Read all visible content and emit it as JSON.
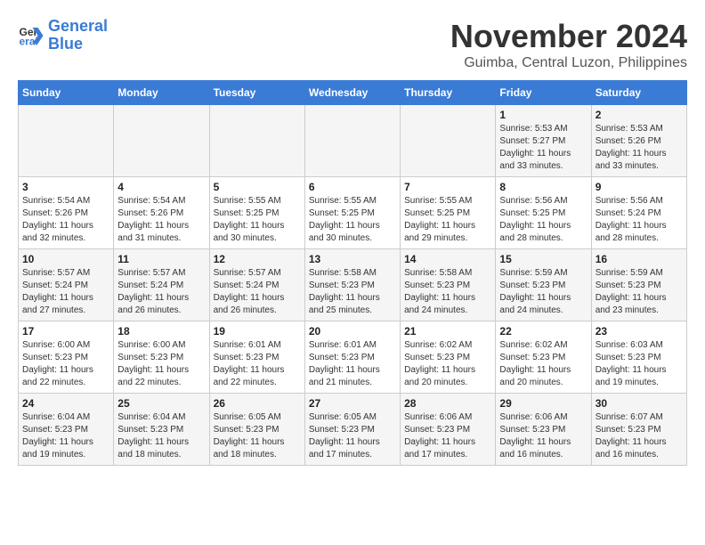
{
  "header": {
    "logo_line1": "General",
    "logo_line2": "Blue",
    "month_title": "November 2024",
    "location": "Guimba, Central Luzon, Philippines"
  },
  "weekdays": [
    "Sunday",
    "Monday",
    "Tuesday",
    "Wednesday",
    "Thursday",
    "Friday",
    "Saturday"
  ],
  "weeks": [
    [
      {
        "day": "",
        "info": ""
      },
      {
        "day": "",
        "info": ""
      },
      {
        "day": "",
        "info": ""
      },
      {
        "day": "",
        "info": ""
      },
      {
        "day": "",
        "info": ""
      },
      {
        "day": "1",
        "info": "Sunrise: 5:53 AM\nSunset: 5:27 PM\nDaylight: 11 hours and 33 minutes."
      },
      {
        "day": "2",
        "info": "Sunrise: 5:53 AM\nSunset: 5:26 PM\nDaylight: 11 hours and 33 minutes."
      }
    ],
    [
      {
        "day": "3",
        "info": "Sunrise: 5:54 AM\nSunset: 5:26 PM\nDaylight: 11 hours and 32 minutes."
      },
      {
        "day": "4",
        "info": "Sunrise: 5:54 AM\nSunset: 5:26 PM\nDaylight: 11 hours and 31 minutes."
      },
      {
        "day": "5",
        "info": "Sunrise: 5:55 AM\nSunset: 5:25 PM\nDaylight: 11 hours and 30 minutes."
      },
      {
        "day": "6",
        "info": "Sunrise: 5:55 AM\nSunset: 5:25 PM\nDaylight: 11 hours and 30 minutes."
      },
      {
        "day": "7",
        "info": "Sunrise: 5:55 AM\nSunset: 5:25 PM\nDaylight: 11 hours and 29 minutes."
      },
      {
        "day": "8",
        "info": "Sunrise: 5:56 AM\nSunset: 5:25 PM\nDaylight: 11 hours and 28 minutes."
      },
      {
        "day": "9",
        "info": "Sunrise: 5:56 AM\nSunset: 5:24 PM\nDaylight: 11 hours and 28 minutes."
      }
    ],
    [
      {
        "day": "10",
        "info": "Sunrise: 5:57 AM\nSunset: 5:24 PM\nDaylight: 11 hours and 27 minutes."
      },
      {
        "day": "11",
        "info": "Sunrise: 5:57 AM\nSunset: 5:24 PM\nDaylight: 11 hours and 26 minutes."
      },
      {
        "day": "12",
        "info": "Sunrise: 5:57 AM\nSunset: 5:24 PM\nDaylight: 11 hours and 26 minutes."
      },
      {
        "day": "13",
        "info": "Sunrise: 5:58 AM\nSunset: 5:23 PM\nDaylight: 11 hours and 25 minutes."
      },
      {
        "day": "14",
        "info": "Sunrise: 5:58 AM\nSunset: 5:23 PM\nDaylight: 11 hours and 24 minutes."
      },
      {
        "day": "15",
        "info": "Sunrise: 5:59 AM\nSunset: 5:23 PM\nDaylight: 11 hours and 24 minutes."
      },
      {
        "day": "16",
        "info": "Sunrise: 5:59 AM\nSunset: 5:23 PM\nDaylight: 11 hours and 23 minutes."
      }
    ],
    [
      {
        "day": "17",
        "info": "Sunrise: 6:00 AM\nSunset: 5:23 PM\nDaylight: 11 hours and 22 minutes."
      },
      {
        "day": "18",
        "info": "Sunrise: 6:00 AM\nSunset: 5:23 PM\nDaylight: 11 hours and 22 minutes."
      },
      {
        "day": "19",
        "info": "Sunrise: 6:01 AM\nSunset: 5:23 PM\nDaylight: 11 hours and 22 minutes."
      },
      {
        "day": "20",
        "info": "Sunrise: 6:01 AM\nSunset: 5:23 PM\nDaylight: 11 hours and 21 minutes."
      },
      {
        "day": "21",
        "info": "Sunrise: 6:02 AM\nSunset: 5:23 PM\nDaylight: 11 hours and 20 minutes."
      },
      {
        "day": "22",
        "info": "Sunrise: 6:02 AM\nSunset: 5:23 PM\nDaylight: 11 hours and 20 minutes."
      },
      {
        "day": "23",
        "info": "Sunrise: 6:03 AM\nSunset: 5:23 PM\nDaylight: 11 hours and 19 minutes."
      }
    ],
    [
      {
        "day": "24",
        "info": "Sunrise: 6:04 AM\nSunset: 5:23 PM\nDaylight: 11 hours and 19 minutes."
      },
      {
        "day": "25",
        "info": "Sunrise: 6:04 AM\nSunset: 5:23 PM\nDaylight: 11 hours and 18 minutes."
      },
      {
        "day": "26",
        "info": "Sunrise: 6:05 AM\nSunset: 5:23 PM\nDaylight: 11 hours and 18 minutes."
      },
      {
        "day": "27",
        "info": "Sunrise: 6:05 AM\nSunset: 5:23 PM\nDaylight: 11 hours and 17 minutes."
      },
      {
        "day": "28",
        "info": "Sunrise: 6:06 AM\nSunset: 5:23 PM\nDaylight: 11 hours and 17 minutes."
      },
      {
        "day": "29",
        "info": "Sunrise: 6:06 AM\nSunset: 5:23 PM\nDaylight: 11 hours and 16 minutes."
      },
      {
        "day": "30",
        "info": "Sunrise: 6:07 AM\nSunset: 5:23 PM\nDaylight: 11 hours and 16 minutes."
      }
    ]
  ]
}
